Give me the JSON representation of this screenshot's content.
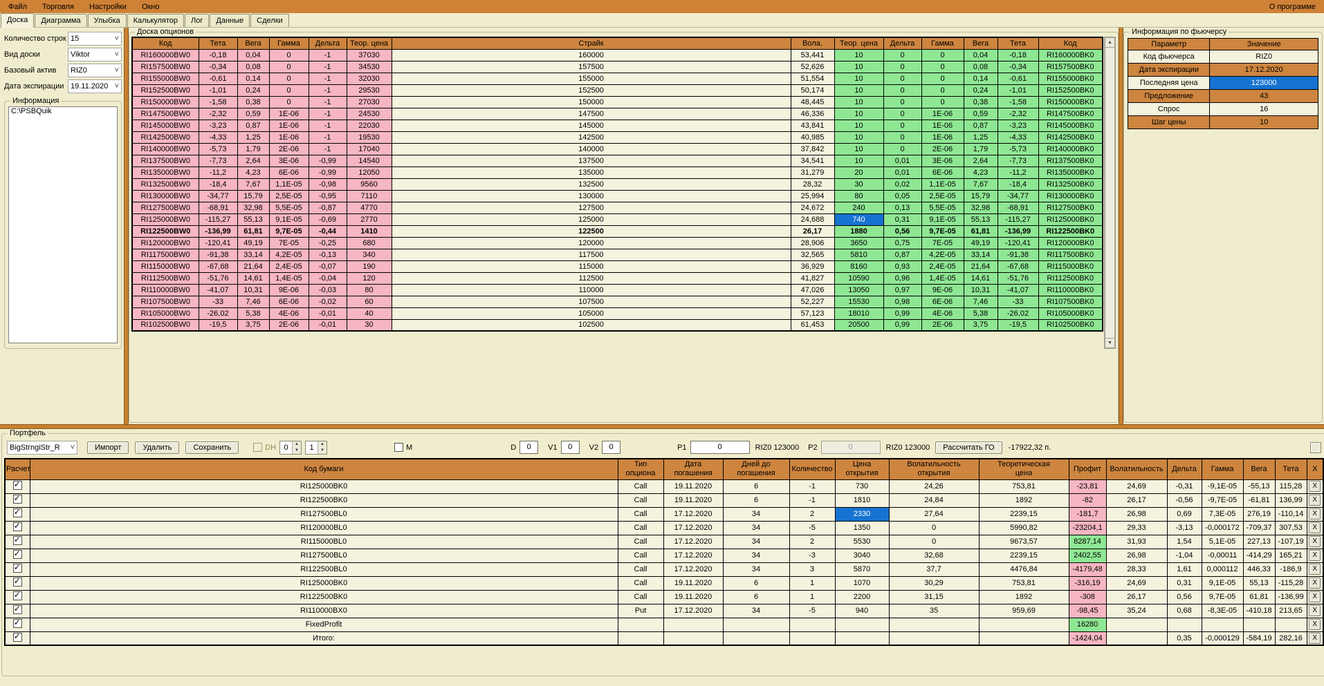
{
  "menu": {
    "items": [
      "Файл",
      "Торговля",
      "Настройки",
      "Окно"
    ],
    "right": "О программе"
  },
  "tabs": [
    "Доска",
    "Диаграмма",
    "Улыбка",
    "Калькулятор",
    "Лог",
    "Данные",
    "Сделки"
  ],
  "active_tab": "Доска",
  "left_panel": {
    "rows": [
      {
        "label": "Количество строк",
        "value": "15"
      },
      {
        "label": "Вид доски",
        "value": "Viktor"
      },
      {
        "label": "Базовый актив",
        "value": "RIZ0"
      },
      {
        "label": "Дата экспирации",
        "value": "19.11.2020"
      }
    ],
    "info_group": "Информация",
    "info_text": "C:\\PSBQuik"
  },
  "options_board": {
    "title": "Доска опционов",
    "headers": [
      "Код",
      "Тета",
      "Вега",
      "Гамма",
      "Дельта",
      "Теор. цена",
      "Страйк",
      "Вола.",
      "Теор. цена",
      "Дельта",
      "Гамма",
      "Вега",
      "Тета",
      "Код"
    ],
    "bold_row_index": 15,
    "selected_cell": {
      "row": 14,
      "col": 8
    },
    "rows": [
      [
        "RI160000BW0",
        "-0,18",
        "0,04",
        "0",
        "-1",
        "37030",
        "160000",
        "53,441",
        "10",
        "0",
        "0",
        "0,04",
        "-0,18",
        "RI160000BK0"
      ],
      [
        "RI157500BW0",
        "-0,34",
        "0,08",
        "0",
        "-1",
        "34530",
        "157500",
        "52,626",
        "10",
        "0",
        "0",
        "0,08",
        "-0,34",
        "RI157500BK0"
      ],
      [
        "RI155000BW0",
        "-0,61",
        "0,14",
        "0",
        "-1",
        "32030",
        "155000",
        "51,554",
        "10",
        "0",
        "0",
        "0,14",
        "-0,61",
        "RI155000BK0"
      ],
      [
        "RI152500BW0",
        "-1,01",
        "0,24",
        "0",
        "-1",
        "29530",
        "152500",
        "50,174",
        "10",
        "0",
        "0",
        "0,24",
        "-1,01",
        "RI152500BK0"
      ],
      [
        "RI150000BW0",
        "-1,58",
        "0,38",
        "0",
        "-1",
        "27030",
        "150000",
        "48,445",
        "10",
        "0",
        "0",
        "0,38",
        "-1,58",
        "RI150000BK0"
      ],
      [
        "RI147500BW0",
        "-2,32",
        "0,59",
        "1E-06",
        "-1",
        "24530",
        "147500",
        "46,336",
        "10",
        "0",
        "1E-06",
        "0,59",
        "-2,32",
        "RI147500BK0"
      ],
      [
        "RI145000BW0",
        "-3,23",
        "0,87",
        "1E-06",
        "-1",
        "22030",
        "145000",
        "43,841",
        "10",
        "0",
        "1E-06",
        "0,87",
        "-3,23",
        "RI145000BK0"
      ],
      [
        "RI142500BW0",
        "-4,33",
        "1,25",
        "1E-06",
        "-1",
        "19530",
        "142500",
        "40,985",
        "10",
        "0",
        "1E-06",
        "1,25",
        "-4,33",
        "RI142500BK0"
      ],
      [
        "RI140000BW0",
        "-5,73",
        "1,79",
        "2E-06",
        "-1",
        "17040",
        "140000",
        "37,842",
        "10",
        "0",
        "2E-06",
        "1,79",
        "-5,73",
        "RI140000BK0"
      ],
      [
        "RI137500BW0",
        "-7,73",
        "2,64",
        "3E-06",
        "-0,99",
        "14540",
        "137500",
        "34,541",
        "10",
        "0,01",
        "3E-06",
        "2,64",
        "-7,73",
        "RI137500BK0"
      ],
      [
        "RI135000BW0",
        "-11,2",
        "4,23",
        "6E-06",
        "-0,99",
        "12050",
        "135000",
        "31,279",
        "20",
        "0,01",
        "6E-06",
        "4,23",
        "-11,2",
        "RI135000BK0"
      ],
      [
        "RI132500BW0",
        "-18,4",
        "7,67",
        "1,1E-05",
        "-0,98",
        "9560",
        "132500",
        "28,32",
        "30",
        "0,02",
        "1,1E-05",
        "7,67",
        "-18,4",
        "RI132500BK0"
      ],
      [
        "RI130000BW0",
        "-34,77",
        "15,79",
        "2,5E-05",
        "-0,95",
        "7110",
        "130000",
        "25,994",
        "80",
        "0,05",
        "2,5E-05",
        "15,79",
        "-34,77",
        "RI130000BK0"
      ],
      [
        "RI127500BW0",
        "-68,91",
        "32,98",
        "5,5E-05",
        "-0,87",
        "4770",
        "127500",
        "24,672",
        "240",
        "0,13",
        "5,5E-05",
        "32,98",
        "-68,91",
        "RI127500BK0"
      ],
      [
        "RI125000BW0",
        "-115,27",
        "55,13",
        "9,1E-05",
        "-0,69",
        "2770",
        "125000",
        "24,688",
        "740",
        "0,31",
        "9,1E-05",
        "55,13",
        "-115,27",
        "RI125000BK0"
      ],
      [
        "RI122500BW0",
        "-136,99",
        "61,81",
        "9,7E-05",
        "-0,44",
        "1410",
        "122500",
        "26,17",
        "1880",
        "0,56",
        "9,7E-05",
        "61,81",
        "-136,99",
        "RI122500BK0"
      ],
      [
        "RI120000BW0",
        "-120,41",
        "49,19",
        "7E-05",
        "-0,25",
        "680",
        "120000",
        "28,906",
        "3650",
        "0,75",
        "7E-05",
        "49,19",
        "-120,41",
        "RI120000BK0"
      ],
      [
        "RI117500BW0",
        "-91,38",
        "33,14",
        "4,2E-05",
        "-0,13",
        "340",
        "117500",
        "32,565",
        "5810",
        "0,87",
        "4,2E-05",
        "33,14",
        "-91,38",
        "RI117500BK0"
      ],
      [
        "RI115000BW0",
        "-67,68",
        "21,64",
        "2,4E-05",
        "-0,07",
        "190",
        "115000",
        "36,929",
        "8160",
        "0,93",
        "2,4E-05",
        "21,64",
        "-67,68",
        "RI115000BK0"
      ],
      [
        "RI112500BW0",
        "-51,76",
        "14,61",
        "1,4E-05",
        "-0,04",
        "120",
        "112500",
        "41,827",
        "10590",
        "0,96",
        "1,4E-05",
        "14,61",
        "-51,76",
        "RI112500BK0"
      ],
      [
        "RI110000BW0",
        "-41,07",
        "10,31",
        "9E-06",
        "-0,03",
        "80",
        "110000",
        "47,026",
        "13050",
        "0,97",
        "9E-06",
        "10,31",
        "-41,07",
        "RI110000BK0"
      ],
      [
        "RI107500BW0",
        "-33",
        "7,46",
        "6E-06",
        "-0,02",
        "60",
        "107500",
        "52,227",
        "15530",
        "0,98",
        "6E-06",
        "7,46",
        "-33",
        "RI107500BK0"
      ],
      [
        "RI105000BW0",
        "-26,02",
        "5,38",
        "4E-06",
        "-0,01",
        "40",
        "105000",
        "57,123",
        "18010",
        "0,99",
        "4E-06",
        "5,38",
        "-26,02",
        "RI105000BK0"
      ],
      [
        "RI102500BW0",
        "-19,5",
        "3,75",
        "2E-06",
        "-0,01",
        "30",
        "102500",
        "61,453",
        "20500",
        "0,99",
        "2E-06",
        "3,75",
        "-19,5",
        "RI102500BK0"
      ]
    ]
  },
  "futures_info": {
    "title": "Информация по фьючерсу",
    "headers": [
      "Параметр",
      "Значение"
    ],
    "rows": [
      {
        "param": "Код фьючерса",
        "value": "RIZ0",
        "style": "plain"
      },
      {
        "param": "Дата экспирации",
        "value": "17.12.2020",
        "style": "orange"
      },
      {
        "param": "Последняя цена",
        "value": "123000",
        "style": "blue"
      },
      {
        "param": "Предложение",
        "value": "43",
        "style": "orange"
      },
      {
        "param": "Спрос",
        "value": "16",
        "style": "plain"
      },
      {
        "param": "Шаг цены",
        "value": "10",
        "style": "orange"
      }
    ]
  },
  "portfolio": {
    "title": "Портфель",
    "strategy_value": "BigStrngiStr_R",
    "buttons": [
      "Импорт",
      "Удалить",
      "Сохранить"
    ],
    "dh_label": "DH",
    "spin1": "0",
    "spin2": "1",
    "m_label": "M",
    "d_label": "D",
    "d_value": "0",
    "v1_label": "V1",
    "v1_value": "0",
    "v2_label": "V2",
    "v2_value": "0",
    "p1_label": "P1",
    "p1_value": "0",
    "p1_note": "RIZ0 123000",
    "p2_label": "P2",
    "p2_value": "0",
    "p2_note": "RIZ0 123000",
    "calc_button": "Рассчитать ГО",
    "result": "-17922,32 п.",
    "table": {
      "headers": [
        "Расчет",
        "Код бумаги",
        "Тип\nопциона",
        "Дата\nпогашения",
        "Дней до\nпогашения",
        "Количество",
        "Цена\nоткрытия",
        "Волатильность\nоткрытия",
        "Теоретическая\nцена",
        "Профит",
        "Волатильность",
        "Дельта",
        "Гамма",
        "Вега",
        "Тета",
        "X"
      ],
      "delete_label": "X",
      "selected": {
        "row": 2,
        "cell": 5
      },
      "rows": [
        {
          "checked": true,
          "profit": "pink",
          "cells": [
            "RI125000BK0",
            "Call",
            "19.11.2020",
            "6",
            "-1",
            "730",
            "24,26",
            "753,81",
            "-23,81",
            "24,69",
            "-0,31",
            "-9,1E-05",
            "-55,13",
            "115,28"
          ]
        },
        {
          "checked": true,
          "profit": "pink",
          "cells": [
            "RI122500BK0",
            "Call",
            "19.11.2020",
            "6",
            "-1",
            "1810",
            "24,84",
            "1892",
            "-82",
            "26,17",
            "-0,56",
            "-9,7E-05",
            "-61,81",
            "136,99"
          ]
        },
        {
          "checked": true,
          "profit": "pink",
          "cells": [
            "RI127500BL0",
            "Call",
            "17.12.2020",
            "34",
            "2",
            "2330",
            "27,64",
            "2239,15",
            "-181,7",
            "26,98",
            "0,69",
            "7,3E-05",
            "276,19",
            "-110,14"
          ]
        },
        {
          "checked": true,
          "profit": "pink",
          "cells": [
            "RI120000BL0",
            "Call",
            "17.12.2020",
            "34",
            "-5",
            "1350",
            "0",
            "5990,82",
            "-23204,1",
            "29,33",
            "-3,13",
            "-0,000172",
            "-709,37",
            "307,53"
          ]
        },
        {
          "checked": true,
          "profit": "green",
          "cells": [
            "RI115000BL0",
            "Call",
            "17.12.2020",
            "34",
            "2",
            "5530",
            "0",
            "9673,57",
            "8287,14",
            "31,93",
            "1,54",
            "5,1E-05",
            "227,13",
            "-107,19"
          ]
        },
        {
          "checked": true,
          "profit": "green",
          "cells": [
            "RI127500BL0",
            "Call",
            "17.12.2020",
            "34",
            "-3",
            "3040",
            "32,68",
            "2239,15",
            "2402,55",
            "26,98",
            "-1,04",
            "-0,00011",
            "-414,29",
            "165,21"
          ]
        },
        {
          "checked": true,
          "profit": "pink",
          "cells": [
            "RI122500BL0",
            "Call",
            "17.12.2020",
            "34",
            "3",
            "5870",
            "37,7",
            "4476,84",
            "-4179,48",
            "28,33",
            "1,61",
            "0,000112",
            "446,33",
            "-186,9"
          ]
        },
        {
          "checked": true,
          "profit": "pink",
          "cells": [
            "RI125000BK0",
            "Call",
            "19.11.2020",
            "6",
            "1",
            "1070",
            "30,29",
            "753,81",
            "-316,19",
            "24,69",
            "0,31",
            "9,1E-05",
            "55,13",
            "-115,28"
          ]
        },
        {
          "checked": true,
          "profit": "pink",
          "cells": [
            "RI122500BK0",
            "Call",
            "19.11.2020",
            "6",
            "1",
            "2200",
            "31,15",
            "1892",
            "-308",
            "26,17",
            "0,56",
            "9,7E-05",
            "61,81",
            "-136,99"
          ]
        },
        {
          "checked": true,
          "profit": "pink",
          "cells": [
            "RI110000BX0",
            "Put",
            "17.12.2020",
            "34",
            "-5",
            "940",
            "35",
            "959,69",
            "-98,45",
            "35,24",
            "0,68",
            "-8,3E-05",
            "-410,18",
            "213,65"
          ]
        },
        {
          "checked": true,
          "profit": "green",
          "cells": [
            "FixedProfit",
            "",
            "",
            "",
            "",
            "",
            "",
            "",
            "16280",
            "",
            "",
            "",
            "",
            ""
          ]
        },
        {
          "checked": true,
          "profit": "pink",
          "cells": [
            "Итого:",
            "",
            "",
            "",
            "",
            "",
            "",
            "",
            "-1424,04",
            "",
            "0,35",
            "-0,000129",
            "-584,19",
            "282,16"
          ]
        }
      ]
    }
  }
}
